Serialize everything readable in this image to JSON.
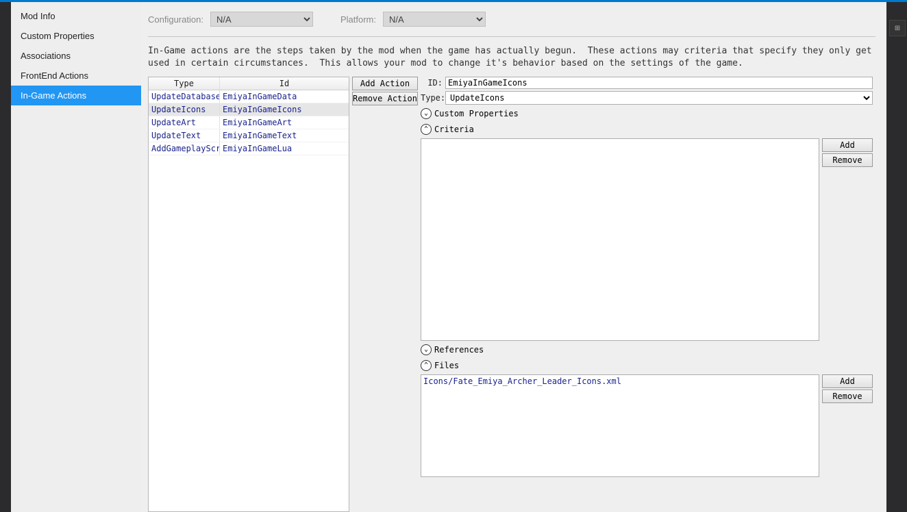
{
  "nav": {
    "items": [
      {
        "label": "Mod Info"
      },
      {
        "label": "Custom Properties"
      },
      {
        "label": "Associations"
      },
      {
        "label": "FrontEnd Actions"
      },
      {
        "label": "In-Game Actions"
      }
    ],
    "activeIndex": 4
  },
  "config": {
    "configuration_label": "Configuration:",
    "configuration_value": "N/A",
    "platform_label": "Platform:",
    "platform_value": "N/A"
  },
  "description": "In-Game actions are the steps taken by the mod when the game has actually begun.  These actions may criteria that specify they only get used in certain circumstances.  This allows your mod to change it's behavior based on the settings of the game.",
  "actions_table": {
    "header_type": "Type",
    "header_id": "Id",
    "rows": [
      {
        "type": "UpdateDatabase",
        "id": "EmiyaInGameData"
      },
      {
        "type": "UpdateIcons",
        "id": "EmiyaInGameIcons"
      },
      {
        "type": "UpdateArt",
        "id": "EmiyaInGameArt"
      },
      {
        "type": "UpdateText",
        "id": "EmiyaInGameText"
      },
      {
        "type": "AddGameplayScri",
        "id": "EmiyaInGameLua"
      }
    ],
    "selectedIndex": 1
  },
  "left_buttons": {
    "add": "Add Action",
    "remove": "Remove Action"
  },
  "detail": {
    "id_label": "ID:",
    "id_value": "EmiyaInGameIcons",
    "type_label": "Type:",
    "type_value": "UpdateIcons",
    "custom_properties_label": "Custom Properties",
    "criteria_label": "Criteria",
    "references_label": "References",
    "files_label": "Files",
    "files_content": "Icons/Fate_Emiya_Archer_Leader_Icons.xml"
  },
  "side_buttons": {
    "add": "Add",
    "remove": "Remove"
  }
}
